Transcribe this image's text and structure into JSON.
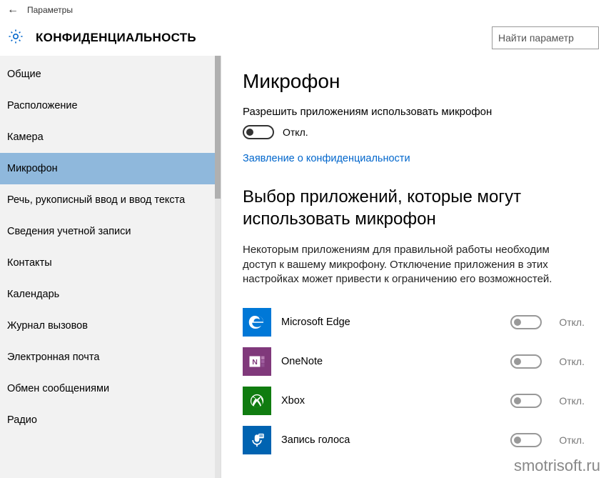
{
  "window": {
    "app_title": "Параметры"
  },
  "header": {
    "title": "КОНФИДЕНЦИАЛЬНОСТЬ",
    "search_placeholder": "Найти параметр"
  },
  "sidebar": {
    "items": [
      {
        "label": "Общие",
        "selected": false
      },
      {
        "label": "Расположение",
        "selected": false
      },
      {
        "label": "Камера",
        "selected": false
      },
      {
        "label": "Микрофон",
        "selected": true
      },
      {
        "label": "Речь, рукописный ввод и ввод текста",
        "selected": false
      },
      {
        "label": "Сведения учетной записи",
        "selected": false
      },
      {
        "label": "Контакты",
        "selected": false
      },
      {
        "label": "Календарь",
        "selected": false
      },
      {
        "label": "Журнал вызовов",
        "selected": false
      },
      {
        "label": "Электронная почта",
        "selected": false
      },
      {
        "label": "Обмен сообщениями",
        "selected": false
      },
      {
        "label": "Радио",
        "selected": false
      }
    ]
  },
  "content": {
    "section_title": "Микрофон",
    "permission_label": "Разрешить приложениям использовать микрофон",
    "main_toggle_state": "Откл.",
    "privacy_link": "Заявление о конфиденциальности",
    "apps_heading": "Выбор приложений, которые могут использовать микрофон",
    "apps_description": "Некоторым приложениям для правильной работы необходим доступ к вашему микрофону. Отключение приложения в этих настройках может привести к ограничению его возможностей.",
    "apps": [
      {
        "name": "Microsoft Edge",
        "state": "Откл.",
        "icon": "edge"
      },
      {
        "name": "OneNote",
        "state": "Откл.",
        "icon": "onenote"
      },
      {
        "name": "Xbox",
        "state": "Откл.",
        "icon": "xbox"
      },
      {
        "name": "Запись голоса",
        "state": "Откл.",
        "icon": "voice"
      }
    ]
  },
  "watermark": "smotrisoft.ru"
}
